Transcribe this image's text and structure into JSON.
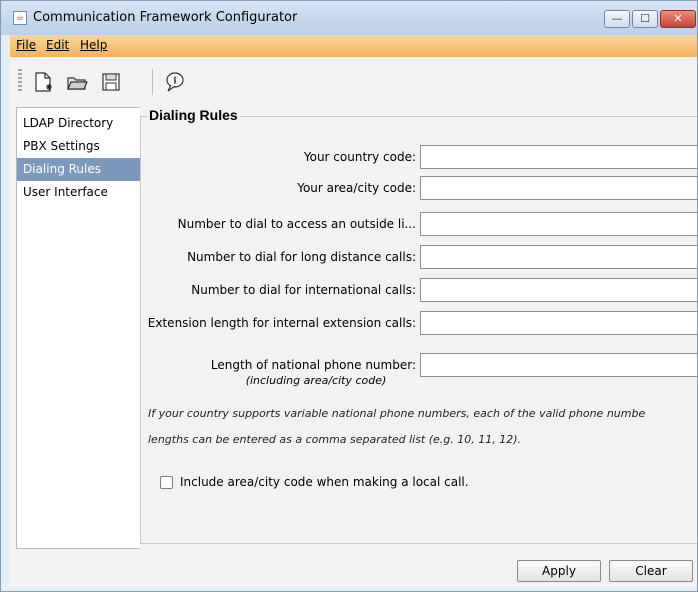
{
  "window": {
    "title": "Communication Framework Configurator",
    "controls": {
      "minimize": "—",
      "maximize": "☐",
      "close": "✕"
    }
  },
  "menubar": {
    "file": "File",
    "edit": "Edit",
    "help": "Help"
  },
  "toolbar": {
    "icons": [
      "new-document-icon",
      "open-folder-icon",
      "save-icon",
      "info-balloon-icon"
    ]
  },
  "sidebar": {
    "items": [
      {
        "label": "LDAP Directory",
        "selected": false
      },
      {
        "label": "PBX Settings",
        "selected": false
      },
      {
        "label": "Dialing Rules",
        "selected": true
      },
      {
        "label": "User Interface",
        "selected": false
      }
    ]
  },
  "main": {
    "section_title": "Dialing Rules",
    "fields": [
      {
        "label": "Your country code:",
        "value": ""
      },
      {
        "label": "Your area/city code:",
        "value": ""
      },
      {
        "label": "Number to dial to access an outside li...",
        "value": ""
      },
      {
        "label": "Number to dial for long distance calls:",
        "value": ""
      },
      {
        "label": "Number to dial for international calls:",
        "value": ""
      },
      {
        "label": "Extension length for internal extension calls:",
        "value": ""
      },
      {
        "label": "Length of national phone number:",
        "sublabel": "(including area/city code)",
        "value": ""
      }
    ],
    "note_line1": "If your country supports variable national phone numbers, each of the valid phone numbe",
    "note_line2": "lengths can be entered as a comma separated list (e.g. 10, 11, 12).",
    "checkbox_label": "Include area/city code when making a local call.",
    "checkbox_checked": false
  },
  "buttons": {
    "apply": "Apply",
    "clear": "Clear"
  },
  "colors": {
    "menubar_accent": "#f6b25d",
    "selected_item": "#7c98bd"
  }
}
